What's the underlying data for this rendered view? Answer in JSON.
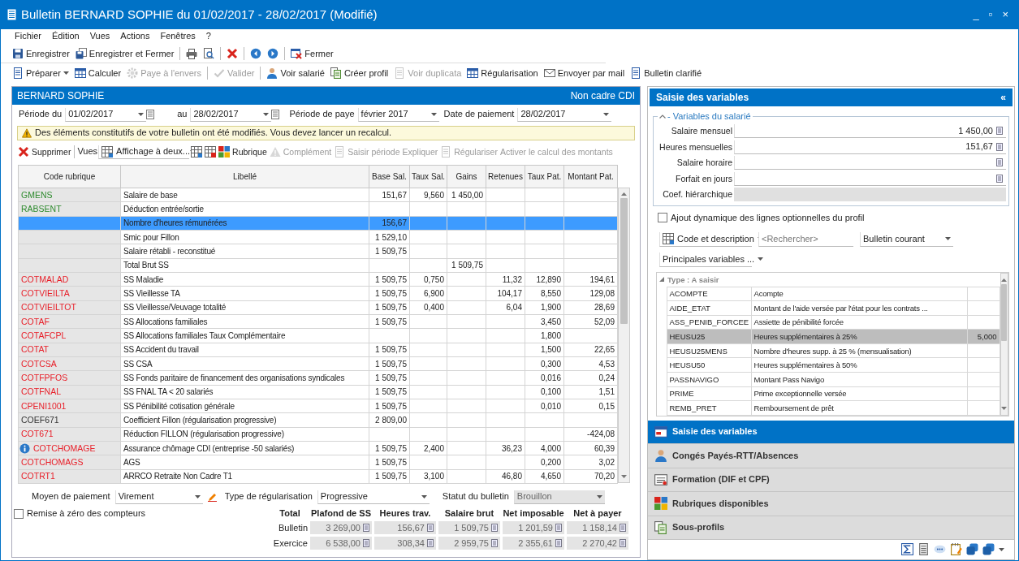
{
  "window": {
    "title": "Bulletin BERNARD SOPHIE du 01/02/2017 - 28/02/2017 (Modifié)",
    "controls": [
      "_",
      "▫",
      "×"
    ]
  },
  "menu": [
    "Fichier",
    "Édition",
    "Vues",
    "Actions",
    "Fenêtres",
    "?"
  ],
  "toolbar_main": [
    {
      "kind": "button",
      "label": "Enregistrer"
    },
    {
      "kind": "button",
      "label": "Enregistrer et Fermer"
    },
    {
      "kind": "separator"
    },
    {
      "kind": "icon"
    },
    {
      "kind": "icon"
    },
    {
      "kind": "separator"
    },
    {
      "kind": "icon"
    },
    {
      "kind": "separator"
    },
    {
      "kind": "icon"
    },
    {
      "kind": "icon"
    },
    {
      "kind": "separator"
    },
    {
      "kind": "button",
      "label": "Fermer"
    }
  ],
  "toolbar_actions": [
    {
      "kind": "dropdown",
      "label": "Préparer",
      "disabled": false
    },
    {
      "kind": "button",
      "label": "Calculer",
      "disabled": false
    },
    {
      "kind": "button",
      "label": "Paye à l'envers",
      "disabled": true
    },
    {
      "kind": "separator"
    },
    {
      "kind": "button",
      "label": "Valider",
      "disabled": true
    },
    {
      "kind": "separator"
    },
    {
      "kind": "button",
      "label": "Voir salarié",
      "disabled": false
    },
    {
      "kind": "button",
      "label": "Créer profil",
      "disabled": false
    },
    {
      "kind": "button",
      "label": "Voir duplicata",
      "disabled": true
    },
    {
      "kind": "button",
      "label": "Régularisation",
      "disabled": false
    },
    {
      "kind": "button",
      "label": "Envoyer par mail",
      "disabled": false
    },
    {
      "kind": "button",
      "label": "Bulletin clarifié",
      "disabled": false
    }
  ],
  "employee": {
    "name": "BERNARD SOPHIE",
    "contract": "Non cadre CDI"
  },
  "period": [
    {
      "kind": "date",
      "label": "Période du",
      "value": "01/02/2017"
    },
    {
      "kind": "date",
      "label": "au",
      "value": "28/02/2017"
    },
    {
      "kind": "select",
      "label": "Période de paye",
      "value": "février 2017"
    },
    {
      "kind": "select",
      "label": "Date de paiement",
      "value": "28/02/2017"
    }
  ],
  "warning": "Des éléments constitutifs de votre bulletin ont été modifiés. Vous devez lancer un recalcul.",
  "grid_toolbar": [
    {
      "kind": "button",
      "label": "Supprimer",
      "disabled": false
    },
    {
      "kind": "separator"
    },
    {
      "kind": "label",
      "label": "Vues"
    },
    {
      "kind": "select",
      "value": "Affichage à deux..."
    },
    {
      "kind": "icon",
      "disabled": false
    },
    {
      "kind": "icon",
      "disabled": false
    },
    {
      "kind": "button",
      "label": "Rubrique",
      "disabled": false
    },
    {
      "kind": "button",
      "label": "Complément",
      "disabled": true
    },
    {
      "kind": "button",
      "label": "Saisir période",
      "disabled": true
    },
    {
      "kind": "button",
      "label": "Expliquer",
      "disabled": true
    },
    {
      "kind": "button",
      "label": "Régulariser",
      "disabled": true
    },
    {
      "kind": "button",
      "label": "Activer le calcul des montants",
      "disabled": true
    }
  ],
  "table": {
    "columns": [
      "Code rubrique",
      "Libellé",
      "Base Sal.",
      "Taux Sal.",
      "Gains",
      "Retenues",
      "Taux Pat.",
      "Montant Pat."
    ],
    "rows": [
      {
        "code": "GMENS",
        "color": "#2e8b2e",
        "label": "Salaire de base",
        "base_sal": "151,67",
        "taux_sal": "9,560",
        "gains": "1 450,00",
        "selected": false,
        "info": false
      },
      {
        "code": "RABSENT",
        "color": "#2e8b2e",
        "label": "Déduction entrée/sortie",
        "selected": false,
        "info": false
      },
      {
        "label": "Nombre d'heures rémunérées",
        "base_sal": "156,67",
        "selected": true,
        "info": false
      },
      {
        "label": "Smic pour Fillon",
        "base_sal": "1 529,10",
        "selected": false,
        "info": false
      },
      {
        "label": "Salaire rétabli - reconstitué",
        "base_sal": "1 509,75",
        "selected": false,
        "info": false
      },
      {
        "label": "Total Brut SS",
        "gains": "1 509,75",
        "selected": false,
        "info": false
      },
      {
        "code": "COTMALAD",
        "color": "#e8202a",
        "label": "SS Maladie",
        "base_sal": "1 509,75",
        "taux_sal": "0,750",
        "retenues": "11,32",
        "taux_pat": "12,890",
        "montant_pat": "194,61",
        "selected": false,
        "info": false
      },
      {
        "code": "COTVIEILTA",
        "color": "#e8202a",
        "label": "SS Vieillesse TA",
        "base_sal": "1 509,75",
        "taux_sal": "6,900",
        "retenues": "104,17",
        "taux_pat": "8,550",
        "montant_pat": "129,08",
        "selected": false,
        "info": false
      },
      {
        "code": "COTVIEILTOT",
        "color": "#e8202a",
        "label": "SS Vieillesse/Veuvage totalité",
        "base_sal": "1 509,75",
        "taux_sal": "0,400",
        "retenues": "6,04",
        "taux_pat": "1,900",
        "montant_pat": "28,69",
        "selected": false,
        "info": false
      },
      {
        "code": "COTAF",
        "color": "#e8202a",
        "label": "SS Allocations familiales",
        "base_sal": "1 509,75",
        "taux_pat": "3,450",
        "montant_pat": "52,09",
        "selected": false,
        "info": false
      },
      {
        "code": "COTAFCPL",
        "color": "#e8202a",
        "label": "SS Allocations familiales Taux Complémentaire",
        "taux_pat": "1,800",
        "selected": false,
        "info": false
      },
      {
        "code": "COTAT",
        "color": "#e8202a",
        "label": "SS Accident du travail",
        "base_sal": "1 509,75",
        "taux_pat": "1,500",
        "montant_pat": "22,65",
        "selected": false,
        "info": false
      },
      {
        "code": "COTCSA",
        "color": "#e8202a",
        "label": "SS CSA",
        "base_sal": "1 509,75",
        "taux_pat": "0,300",
        "montant_pat": "4,53",
        "selected": false,
        "info": false
      },
      {
        "code": "COTFPFOS",
        "color": "#e8202a",
        "label": "SS Fonds paritaire de financement des organisations syndicales",
        "base_sal": "1 509,75",
        "taux_pat": "0,016",
        "montant_pat": "0,24",
        "selected": false,
        "info": false
      },
      {
        "code": "COTFNAL",
        "color": "#e8202a",
        "label": "SS FNAL TA < 20 salariés",
        "base_sal": "1 509,75",
        "taux_pat": "0,100",
        "montant_pat": "1,51",
        "selected": false,
        "info": false
      },
      {
        "code": "CPENI1001",
        "color": "#e8202a",
        "label": "SS Pénibilité cotisation générale",
        "base_sal": "1 509,75",
        "taux_pat": "0,010",
        "montant_pat": "0,15",
        "selected": false,
        "info": false
      },
      {
        "code": "COEF671",
        "color": "#333333",
        "label": "Coefficient Fillon (régularisation progressive)",
        "base_sal": "2 809,00",
        "selected": false,
        "info": false
      },
      {
        "code": "COT671",
        "color": "#e8202a",
        "label": "Réduction FILLON (régularisation progressive)",
        "montant_pat": "-424,08",
        "selected": false,
        "info": false
      },
      {
        "code": "COTCHOMAGE",
        "color": "#e8202a",
        "label": "Assurance chômage CDI (entreprise -50 salariés)",
        "base_sal": "1 509,75",
        "taux_sal": "2,400",
        "retenues": "36,23",
        "taux_pat": "4,000",
        "montant_pat": "60,39",
        "selected": false,
        "info": true
      },
      {
        "code": "COTCHOMAGS",
        "color": "#e8202a",
        "label": "AGS",
        "base_sal": "1 509,75",
        "taux_pat": "0,200",
        "montant_pat": "3,02",
        "selected": false,
        "info": false
      },
      {
        "code": "COTRT1",
        "color": "#e8202a",
        "label": "ARRCO Retraite Non Cadre T1",
        "base_sal": "1 509,75",
        "taux_sal": "3,100",
        "retenues": "46,80",
        "taux_pat": "4,650",
        "montant_pat": "70,20",
        "selected": false,
        "info": false
      }
    ]
  },
  "payment": [
    {
      "label": "Moyen de paiement",
      "value": "Virement",
      "disabled": false
    },
    {
      "label": "Type de régularisation",
      "value": "Progressive",
      "disabled": false
    },
    {
      "label": "Statut du bulletin",
      "value": "Brouillon",
      "disabled": true
    }
  ],
  "reset_counters": {
    "label": "Remise à zéro des compteurs",
    "checked": false
  },
  "totals": {
    "columns": [
      "Total",
      "Plafond de SS",
      "Heures trav.",
      "Salaire brut",
      "Net imposable",
      "Net à payer"
    ],
    "rows": [
      {
        "label": "Bulletin",
        "values": [
          "3 269,00",
          "156,67",
          "1 509,75",
          "1 201,59",
          "1 158,14"
        ]
      },
      {
        "label": "Exercice",
        "values": [
          "6 538,00",
          "308,34",
          "2 959,75",
          "2 355,61",
          "2 270,42"
        ]
      }
    ]
  },
  "side_panel": {
    "title": "Saisie des variables",
    "collapse": "«",
    "section": {
      "legend": "- Variables du salarié",
      "expanded": true,
      "fields": [
        {
          "label": "Salaire mensuel",
          "value": "1 450,00",
          "disabled": false
        },
        {
          "label": "Heures mensuelles",
          "value": "151,67",
          "disabled": false
        },
        {
          "label": "Salaire horaire",
          "disabled": false
        },
        {
          "label": "Forfait en jours",
          "disabled": false
        },
        {
          "label": "Coef. hiérarchique",
          "disabled": true
        }
      ]
    },
    "dynamic_lines": {
      "label": "Ajout dynamique des lignes optionnelles du profil",
      "checked": false
    },
    "filters": [
      {
        "kind": "select",
        "value": "Code et description"
      },
      {
        "kind": "search",
        "placeholder": "<Rechercher>"
      },
      {
        "kind": "select",
        "value": "Bulletin courant"
      },
      {
        "kind": "select",
        "value": "Principales variables ..."
      }
    ],
    "variables": {
      "group": "Type : A saisir",
      "expanded": true,
      "rows": [
        {
          "code": "ACOMPTE",
          "label": "Acompte",
          "selected": false
        },
        {
          "code": "AIDE_ETAT",
          "label": "Montant de l'aide versée par l'état pour les contrats ...",
          "selected": false
        },
        {
          "code": "ASS_PENIB_FORCEE",
          "label": "Assiette de pénibilité forcée",
          "selected": false
        },
        {
          "code": "HEUSU25",
          "label": "Heures supplémentaires à 25%",
          "value": "5,000",
          "selected": true
        },
        {
          "code": "HEUSU25MENS",
          "label": "Nombre d'heures supp. à 25 % (mensualisation)",
          "selected": false
        },
        {
          "code": "HEUSU50",
          "label": "Heures supplémentaires à 50%",
          "selected": false
        },
        {
          "code": "PASSNAVIGO",
          "label": "Montant Pass Navigo",
          "selected": false
        },
        {
          "code": "PRIME",
          "label": "Prime exceptionnelle versée",
          "selected": false
        },
        {
          "code": "REMB_PRET",
          "label": "Remboursement de prêt",
          "selected": false
        }
      ]
    },
    "accordion": [
      {
        "label": "Saisie des variables",
        "selected": true
      },
      {
        "label": "Congés Payés-RTT/Absences",
        "selected": false
      },
      {
        "label": "Formation (DIF et CPF)",
        "selected": false
      },
      {
        "label": "Rubriques disponibles",
        "selected": false
      },
      {
        "label": "Sous-profils",
        "selected": false
      }
    ]
  }
}
